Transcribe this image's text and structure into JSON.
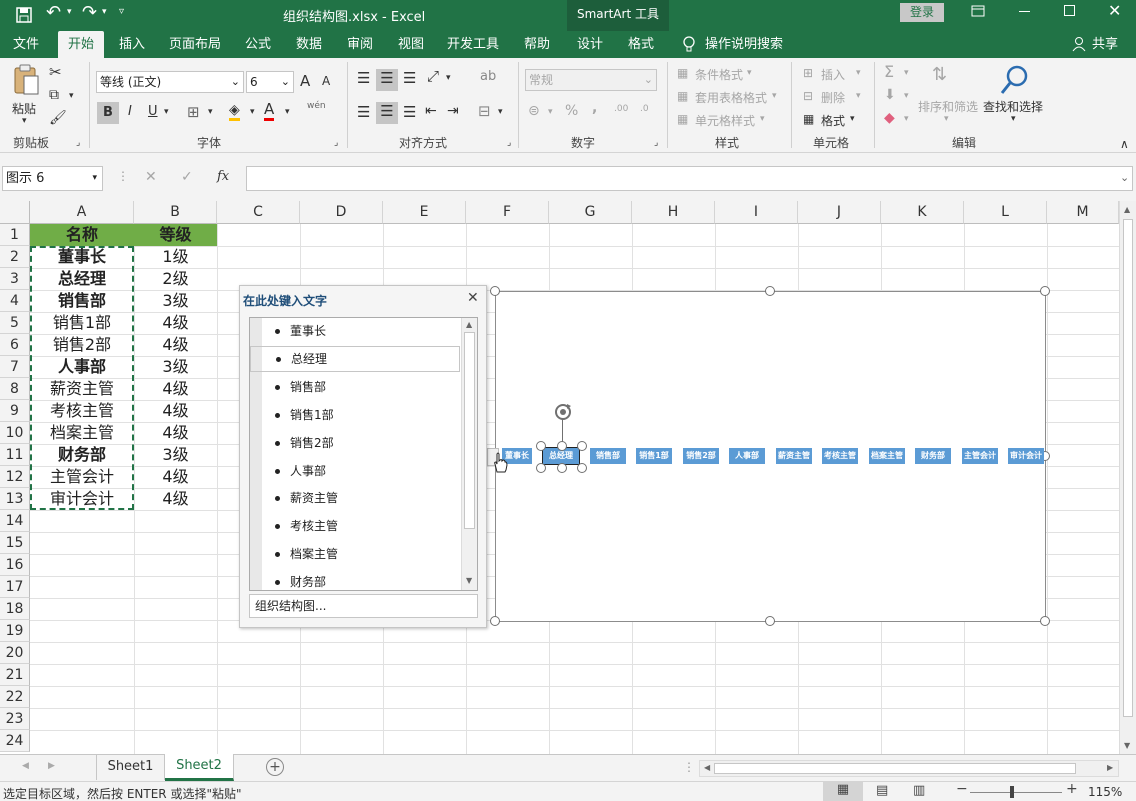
{
  "window": {
    "title": "组织结构图.xlsx  -  Excel",
    "tool_context": "SmartArt 工具",
    "login": "登录"
  },
  "ribbon_tabs": [
    "文件",
    "开始",
    "插入",
    "页面布局",
    "公式",
    "数据",
    "审阅",
    "视图",
    "开发工具",
    "帮助",
    "设计",
    "格式"
  ],
  "tell_me": "操作说明搜索",
  "share": "共享",
  "ribbon": {
    "clipboard": {
      "paste": "粘贴",
      "label": "剪贴板"
    },
    "font": {
      "name": "等线 (正文)",
      "size": "6",
      "bold": "B",
      "italic": "I",
      "underline": "U",
      "label": "字体",
      "grow": "A",
      "shrink": "A",
      "phonetic": "wén"
    },
    "alignment": {
      "label": "对齐方式"
    },
    "number": {
      "format": "常规",
      "label": "数字",
      "percent": "%",
      "comma": ","
    },
    "styles": {
      "conditional": "条件格式",
      "table": "套用表格格式",
      "cell": "单元格样式",
      "label": "样式"
    },
    "cells": {
      "insert": "插入",
      "delete": "删除",
      "format": "格式",
      "label": "单元格"
    },
    "editing": {
      "sort": "排序和筛选",
      "find": "查找和选择",
      "label": "编辑"
    }
  },
  "formula_bar": {
    "name_box": "图示 6",
    "formula": ""
  },
  "columns": [
    "A",
    "B",
    "C",
    "D",
    "E",
    "F",
    "G",
    "H",
    "I",
    "J",
    "K",
    "L",
    "M"
  ],
  "rows": [
    "1",
    "2",
    "3",
    "4",
    "5",
    "6",
    "7",
    "8",
    "9",
    "10",
    "11",
    "12",
    "13",
    "14",
    "15",
    "16",
    "17",
    "18",
    "19",
    "20",
    "21",
    "22",
    "23",
    "24"
  ],
  "cells": {
    "header": [
      "名称",
      "等级"
    ],
    "data": [
      [
        "董事长",
        "1级"
      ],
      [
        "总经理",
        "2级"
      ],
      [
        "销售部",
        "3级"
      ],
      [
        "销售1部",
        "4级"
      ],
      [
        "销售2部",
        "4级"
      ],
      [
        "人事部",
        "3级"
      ],
      [
        "薪资主管",
        "4级"
      ],
      [
        "考核主管",
        "4级"
      ],
      [
        "档案主管",
        "4级"
      ],
      [
        "财务部",
        "3级"
      ],
      [
        "主管会计",
        "4级"
      ],
      [
        "审计会计",
        "4级"
      ]
    ]
  },
  "text_pane": {
    "title": "在此处键入文字",
    "items": [
      "董事长",
      "总经理",
      "销售部",
      "销售1部",
      "销售2部",
      "人事部",
      "薪资主管",
      "考核主管",
      "档案主管",
      "财务部"
    ],
    "footer": "组织结构图..."
  },
  "smartart_nodes": [
    "董事长",
    "总经理",
    "销售部",
    "销售1部",
    "销售2部",
    "人事部",
    "薪资主管",
    "考核主管",
    "档案主管",
    "财务部",
    "主管会计",
    "审计会计"
  ],
  "sheets": [
    "Sheet1",
    "Sheet2"
  ],
  "status": {
    "message": "选定目标区域，然后按 ENTER 或选择\"粘贴\"",
    "zoom": "115%"
  },
  "colors": {
    "excel_green": "#217346",
    "smartart_node": "#5b9bd5",
    "header_fill": "#70ad47"
  }
}
